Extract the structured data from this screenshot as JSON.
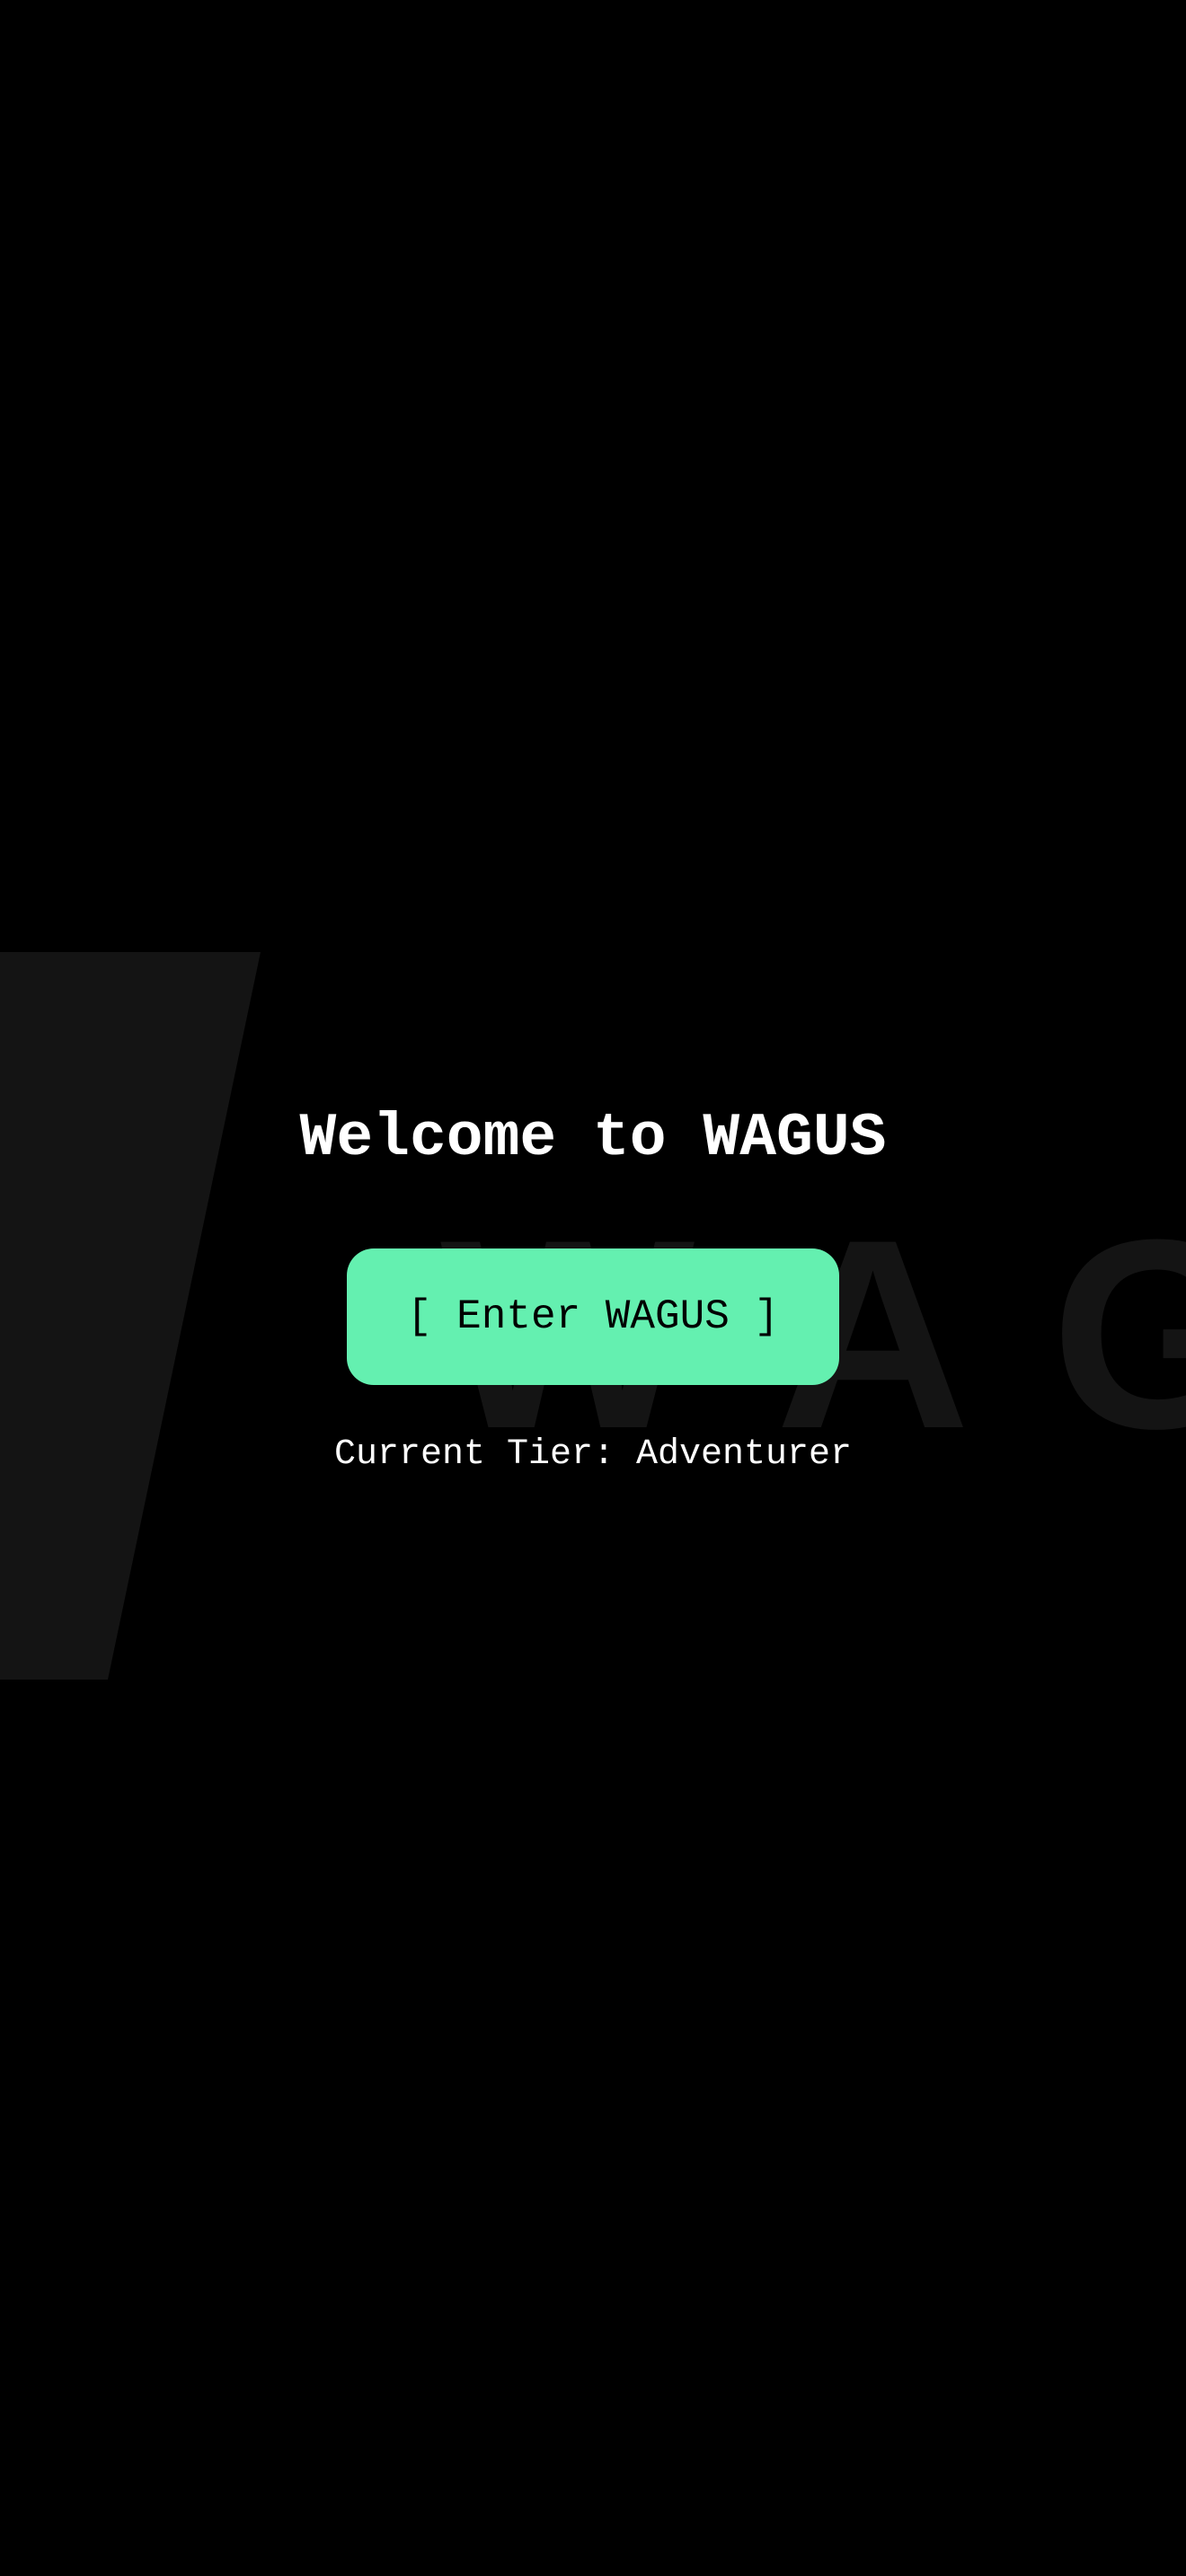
{
  "background": {
    "color": "#000000",
    "watermark_color": "#141414",
    "watermark_letters": [
      "W",
      "A",
      "G"
    ]
  },
  "welcome": {
    "title": "Welcome to WAGUS"
  },
  "enter_button": {
    "label": "[ Enter WAGUS ]",
    "color": "#64f0b0"
  },
  "tier": {
    "text": "Current Tier: Adventurer"
  }
}
